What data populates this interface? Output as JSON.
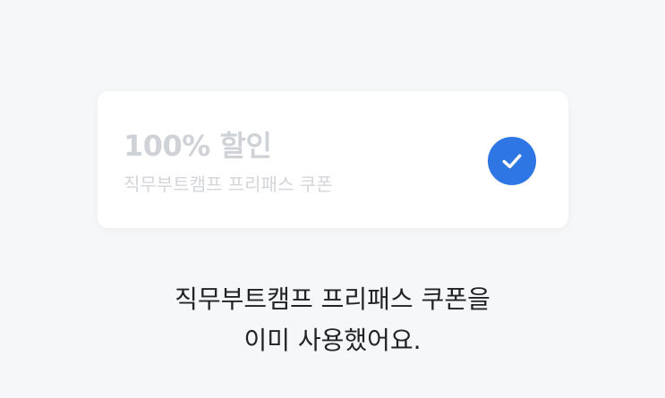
{
  "coupon": {
    "title": "100% 할인",
    "subtitle": "직무부트캠프 프리패스 쿠폰",
    "status_icon": "check-icon",
    "accent_color": "#2e76e4"
  },
  "message": {
    "line1": "직무부트캠프 프리패스 쿠폰을",
    "line2": "이미 사용했어요."
  }
}
